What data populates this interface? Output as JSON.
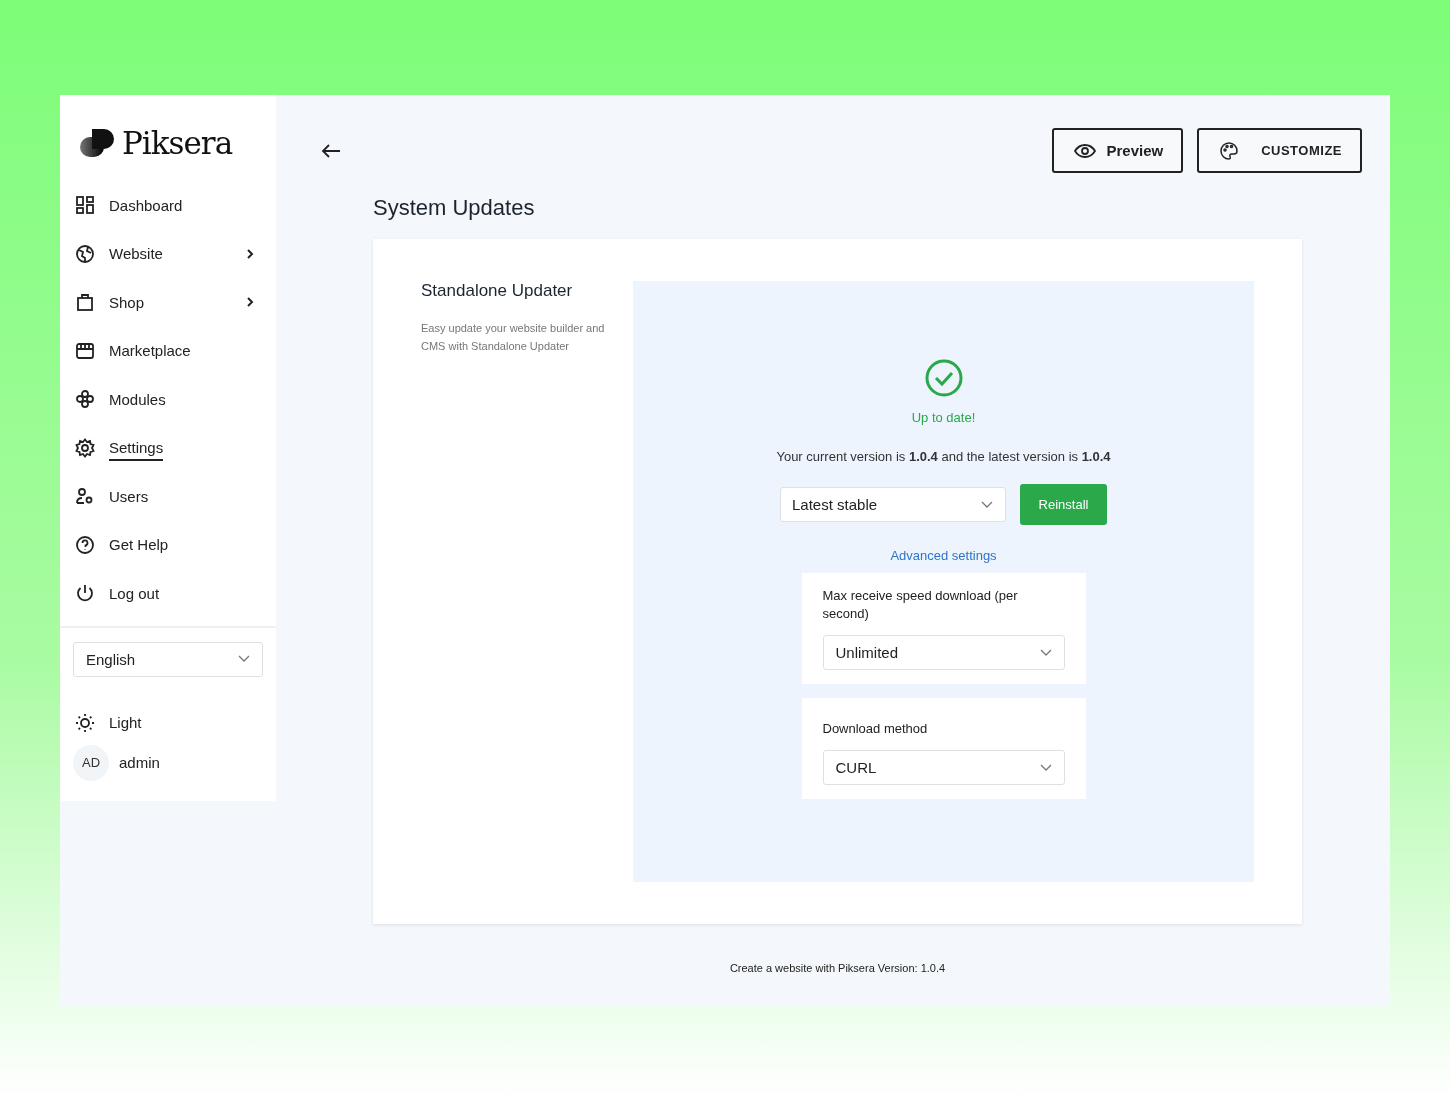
{
  "brand": {
    "name": "Piksera"
  },
  "nav": [
    {
      "label": "Dashboard",
      "selected": false,
      "expandable": false
    },
    {
      "label": "Website",
      "selected": false,
      "expandable": true
    },
    {
      "label": "Shop",
      "selected": false,
      "expandable": true
    },
    {
      "label": "Marketplace",
      "selected": false,
      "expandable": false
    },
    {
      "label": "Modules",
      "selected": false,
      "expandable": false
    },
    {
      "label": "Settings",
      "selected": true,
      "expandable": false
    },
    {
      "label": "Users",
      "selected": false,
      "expandable": false
    },
    {
      "label": "Get Help",
      "selected": false,
      "expandable": false
    },
    {
      "label": "Log out",
      "selected": false,
      "expandable": false
    }
  ],
  "language": {
    "value": "English"
  },
  "theme": {
    "label": "Light"
  },
  "user": {
    "initials": "AD",
    "name": "admin"
  },
  "header": {
    "buttons": [
      {
        "kind": "preview",
        "label": "Preview"
      },
      {
        "kind": "customize",
        "label": "CUSTOMIZE"
      }
    ]
  },
  "page_title": "System Updates",
  "updater": {
    "title": "Standalone Updater",
    "description": "Easy update your website builder and CMS with Standalone Updater",
    "status": "Up to date!",
    "version_text": "Your current version is **1.0.4** and the latest version is **1.0.4**",
    "channel": {
      "value": "Latest stable"
    },
    "action": "Reinstall",
    "advanced_link": "Advanced settings",
    "settings": [
      {
        "label": "Max receive speed download (per second)",
        "value": "Unlimited"
      },
      {
        "label": "Download method",
        "value": "CURL"
      }
    ]
  },
  "footer": "Create a website with Piksera Version: 1.0.4"
}
